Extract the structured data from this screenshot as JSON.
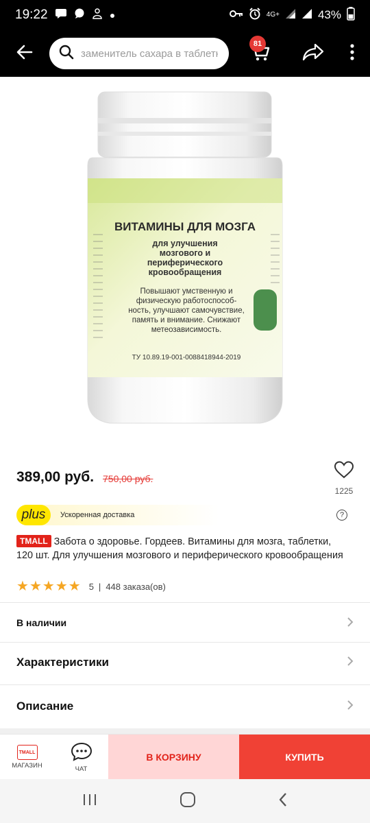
{
  "status_bar": {
    "time": "19:22",
    "network": "4G+",
    "battery": "43%"
  },
  "top_bar": {
    "search_placeholder": "заменитель сахара в таблетках",
    "cart_count": "81"
  },
  "product": {
    "image_texts": {
      "brand_title": "ВИТАМИНЫ ДЛЯ МОЗГА",
      "subtitle_lines": [
        "для улучшения",
        "мозгового и",
        "периферического",
        "кровообращения"
      ],
      "claim_lines": [
        "Повышают умственную и",
        "физическую работоспособ-",
        "ность, улучшают самочувствие,",
        "память и внимание. Снижают",
        "метеозависимость."
      ],
      "standard": "ТУ 10.89.19-001-0088418944-2019"
    },
    "price": "389,00 руб.",
    "old_price": "750,00 руб.",
    "favorites_count": "1225",
    "plus_logo": "plus",
    "plus_text": "Ускоренная доставка",
    "badge": "TMALL",
    "title": "Забота о здоровье. Гордеев. Витамины для мозга, таблетки, 120 шт. Для улучшения мозгового и периферического кровообращения",
    "rating": "5",
    "rating_stars": 5,
    "orders": "448 заказа(ов)"
  },
  "sections": {
    "availability": "В наличии",
    "characteristics": "Характеристики",
    "description": "Описание"
  },
  "action_bar": {
    "shop_logo": "TMALL",
    "shop_label": "МАГАЗИН",
    "chat_label": "ЧАТ",
    "cart_label": "В КОРЗИНУ",
    "buy_label": "КУПИТЬ"
  },
  "colors": {
    "accent_red": "#e2231a",
    "buy_red": "#f04135",
    "cart_pink": "#ffd6d6",
    "plus_yellow": "#ffe600",
    "star": "#f5a623"
  }
}
